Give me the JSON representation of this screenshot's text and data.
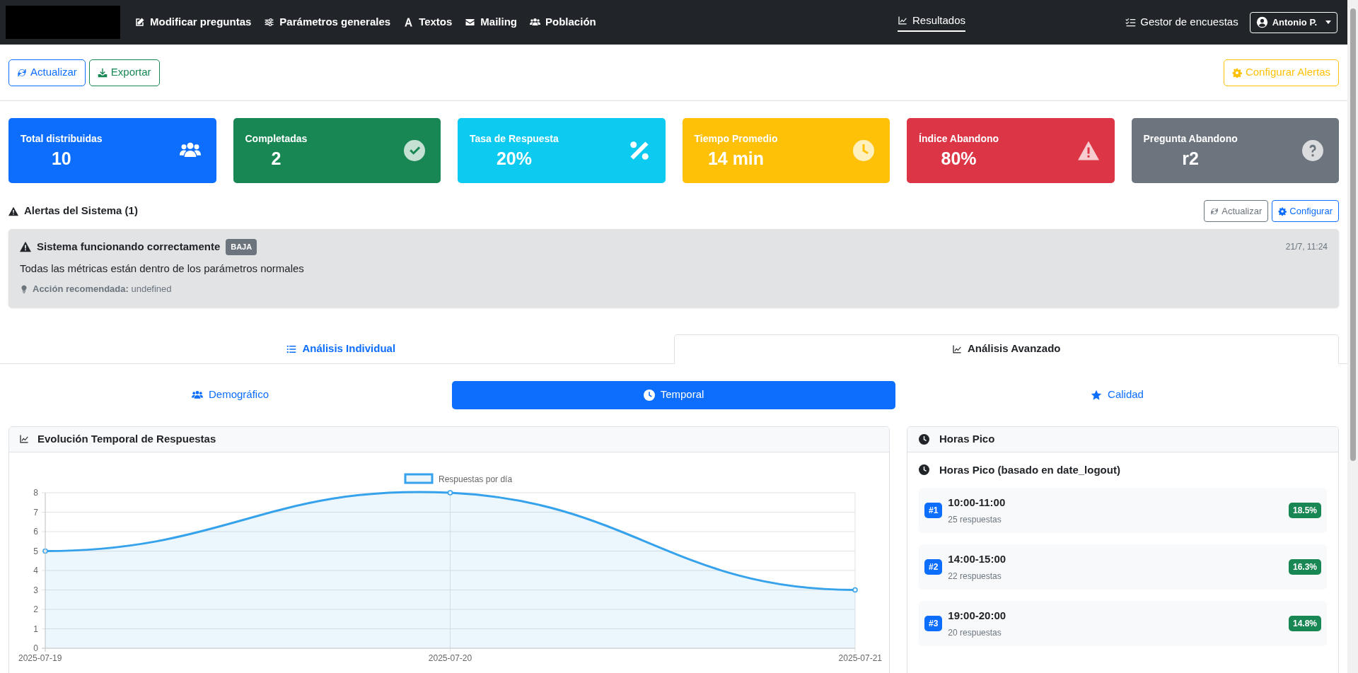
{
  "nav": {
    "items": [
      {
        "label": "Modificar preguntas",
        "selected": false
      },
      {
        "label": "Parámetros generales",
        "selected": false
      },
      {
        "label": "Textos",
        "selected": false
      },
      {
        "label": "Mailing",
        "selected": false
      },
      {
        "label": "Población",
        "selected": false
      }
    ],
    "center_item": {
      "label": "Resultados",
      "selected": true
    },
    "manager_link": "Gestor de encuestas",
    "user_menu": "Antonio P."
  },
  "toolbar": {
    "refresh": "Actualizar",
    "export": "Exportar",
    "alerts_config": "Configurar Alertas"
  },
  "stats": [
    {
      "label": "Total distribuidas",
      "value": "10",
      "color": "#0d6efd"
    },
    {
      "label": "Completadas",
      "value": "2",
      "color": "#198754"
    },
    {
      "label": "Tasa de Respuesta",
      "value": "20%",
      "color": "#0dcaf0"
    },
    {
      "label": "Tiempo Promedio",
      "value": "14 min",
      "color": "#ffc107"
    },
    {
      "label": "Índice Abandono",
      "value": "80%",
      "color": "#dc3545"
    },
    {
      "label": "Pregunta Abandono",
      "value": "r2",
      "color": "#6c757d"
    }
  ],
  "alerts": {
    "title": "Alertas del Sistema (1)",
    "refresh": "Actualizar",
    "configure": "Configurar",
    "items": [
      {
        "title": "Sistema funcionando correctamente",
        "severity": "BAJA",
        "time": "21/7, 11:24",
        "message": "Todas las métricas están dentro de los parámetros normales",
        "action": "**Acción recomendada:** undefined"
      }
    ]
  },
  "tabs": [
    {
      "label": "Análisis Individual",
      "selected": false
    },
    {
      "label": "Análisis Avanzado",
      "selected": true
    }
  ],
  "subtabs": [
    {
      "label": "Demográfico",
      "selected": false
    },
    {
      "label": "Temporal",
      "selected": true
    },
    {
      "label": "Calidad",
      "selected": false
    }
  ],
  "evolution": {
    "title": "Evolución Temporal de Respuestas",
    "chart_data": {
      "type": "area",
      "categories": [
        "2025-07-19",
        "2025-07-20",
        "2025-07-21"
      ],
      "series": [
        {
          "name": "Respuestas por día",
          "color": "#36a2eb",
          "values": [
            5,
            8,
            3
          ]
        }
      ],
      "ylim": [
        0,
        8
      ],
      "grid": true,
      "yticks": [
        0,
        1,
        2,
        3,
        4,
        5,
        6,
        7,
        8
      ]
    }
  },
  "peak_hours": {
    "title": "Horas Pico",
    "subtitle": "Horas Pico (basado en date_logout)",
    "items": [
      {
        "rank": "#1",
        "range": "10:00-11:00",
        "count": "25 respuestas",
        "share": "18.5%"
      },
      {
        "rank": "#2",
        "range": "14:00-15:00",
        "count": "22 respuestas",
        "share": "16.3%"
      },
      {
        "rank": "#3",
        "range": "19:00-20:00",
        "count": "20 respuestas",
        "share": "14.8%"
      }
    ]
  }
}
